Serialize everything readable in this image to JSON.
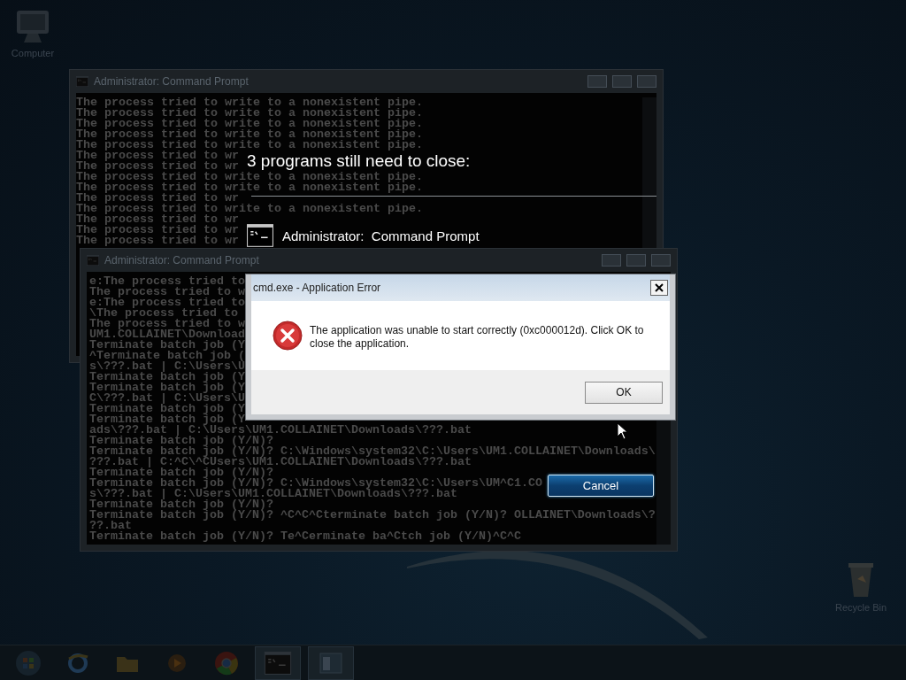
{
  "desktop": {
    "icons": [
      {
        "kind": "computer",
        "label": "Computer"
      },
      {
        "kind": "recycle",
        "label": "Recycle Bin"
      }
    ]
  },
  "windows": [
    {
      "title": "Administrator:  Command Prompt",
      "lines": [
        "The process tried to write to a nonexistent pipe.",
        "The process tried to write to a nonexistent pipe.",
        "The process tried to write to a nonexistent pipe.",
        "The process tried to write to a nonexistent pipe.",
        "The process tried to write to a nonexistent pipe.",
        "The process tried to wr",
        "The process tried to wr",
        "The process tried to write to a nonexistent pipe.",
        "The process tried to write to a nonexistent pipe.",
        "The process tried to wr",
        "The process tried to write to a nonexistent pipe.",
        "The process tried to wr",
        "The process tried to wr",
        "The process tried to wr"
      ]
    },
    {
      "title": "Administrator:  Command Prompt",
      "lines": [
        "e:The process tried to",
        "The process tried to w",
        "e:The process tried to",
        "\\The process tried to",
        "The process tried to w",
        "UM1.COLLAINET\\Download",
        "Terminate batch job (Y",
        "^Terminate batch job (",
        "s\\???.bat | C:\\Users\\U",
        "Terminate batch job (Y",
        "Terminate batch job (Y",
        "C\\???.bat | C:\\Users\\U",
        "Terminate batch job (Y",
        "Terminate batch job (Y",
        "ads\\???.bat | C:\\Users\\UM1.COLLAINET\\Downloads\\???.bat",
        "Terminate batch job (Y/N)?",
        "Terminate batch job (Y/N)? C:\\Windows\\system32\\C:\\Users\\UM1.COLLAINET\\Downloads\\",
        "???.bat | C:^C\\^CUsers\\UM1.COLLAINET\\Downloads\\???.bat",
        "Terminate batch job (Y/N)?",
        "Terminate batch job (Y/N)? C:\\Windows\\system32\\C:\\Users\\UM^C1.CO",
        "s\\???.bat | C:\\Users\\UM1.COLLAINET\\Downloads\\???.bat",
        "Terminate batch job (Y/N)?",
        "Terminate batch job (Y/N)? ^C^C^Cterminate batch job (Y/N)? OLLAINET\\Downloads\\?",
        "??.bat",
        "Terminate batch job (Y/N)? Te^Cerminate ba^Ctch job (Y/N)^C^C"
      ]
    }
  ],
  "shutdown": {
    "heading": "3 programs still need to close:",
    "programs": [
      {
        "name": "Administrator:  Command Prompt"
      }
    ],
    "cancel": "Cancel"
  },
  "dialog": {
    "title": "cmd.exe - Application Error",
    "message": "The application was unable to start correctly (0xc000012d). Click OK to close the application.",
    "button": "OK"
  },
  "taskbar": {
    "items": [
      {
        "kind": "start",
        "selected": false
      },
      {
        "kind": "browser",
        "selected": false
      },
      {
        "kind": "folder",
        "selected": false
      },
      {
        "kind": "media",
        "selected": false
      },
      {
        "kind": "chrome",
        "selected": false
      },
      {
        "kind": "console",
        "selected": true
      },
      {
        "kind": "window",
        "selected": true
      }
    ]
  }
}
